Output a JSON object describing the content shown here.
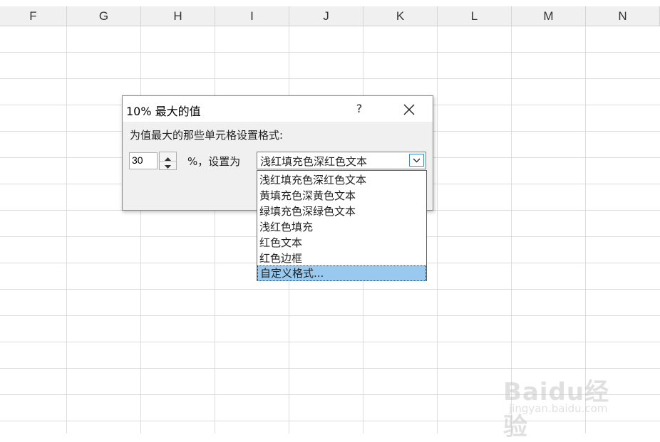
{
  "spreadsheet": {
    "columns": [
      "F",
      "G",
      "H",
      "I",
      "J",
      "K",
      "L",
      "M",
      "N"
    ]
  },
  "dialog": {
    "title": "10% 最大的值",
    "help_label": "?",
    "prompt": "为值最大的那些单元格设置格式:",
    "count_value": "30",
    "percent_label": "%，设置为",
    "selected_format": "浅红填充色深红色文本"
  },
  "dropdown": {
    "options": [
      "浅红填充色深红色文本",
      "黄填充色深黄色文本",
      "绿填充色深绿色文本",
      "浅红色填充",
      "红色文本",
      "红色边框",
      "自定义格式..."
    ],
    "highlighted_index": 6
  },
  "watermark": {
    "logo_text": "Baidu经验",
    "url": "jingyan.baidu.com"
  },
  "colors": {
    "header_bg": "#f0f0f0",
    "gridline": "#dcdcdc",
    "highlight": "#99c9ef",
    "dialog_body": "#f0f0f0"
  }
}
